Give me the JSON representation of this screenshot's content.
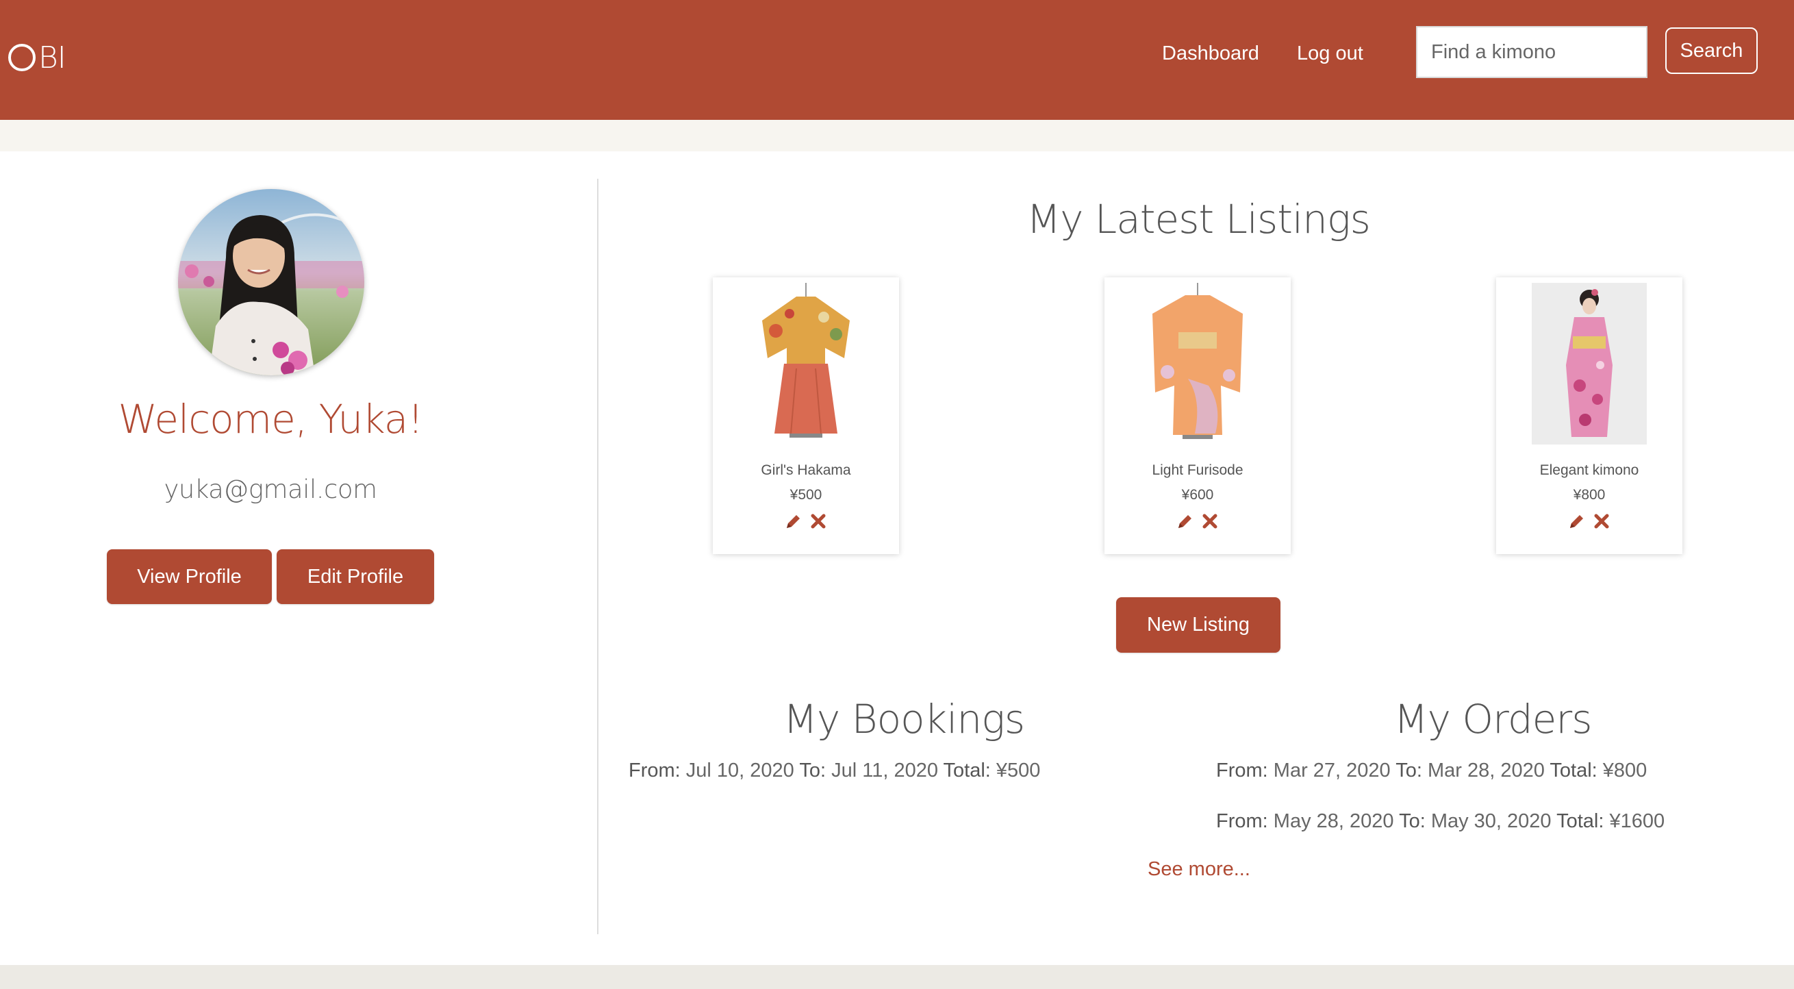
{
  "brand": {
    "logo_text": "BI",
    "accent": "#b04a33"
  },
  "nav": {
    "dashboard": "Dashboard",
    "logout": "Log out",
    "search_placeholder": "Find a kimono",
    "search_button": "Search"
  },
  "profile": {
    "welcome": "Welcome, Yuka!",
    "email": "yuka@gmail.com",
    "view_button": "View Profile",
    "edit_button": "Edit Profile"
  },
  "listings": {
    "title": "My Latest Listings",
    "items": [
      {
        "name": "Girl's Hakama",
        "price": "¥500",
        "image": "kimono-hakama-image"
      },
      {
        "name": "Light Furisode",
        "price": "¥600",
        "image": "kimono-furisode-image"
      },
      {
        "name": "Elegant kimono",
        "price": "¥800",
        "image": "kimono-elegant-image"
      }
    ],
    "new_button": "New Listing"
  },
  "labels": {
    "from": "From:",
    "to": "To:",
    "total": "Total:"
  },
  "bookings": {
    "title": "My Bookings",
    "rows": [
      {
        "from": "Jul 10, 2020",
        "to": "Jul 11, 2020",
        "total": "¥500"
      }
    ]
  },
  "orders": {
    "title": "My Orders",
    "rows": [
      {
        "from": "Mar 27, 2020",
        "to": "Mar 28, 2020",
        "total": "¥800"
      },
      {
        "from": "May 28, 2020",
        "to": "May 30, 2020",
        "total": "¥1600"
      }
    ],
    "see_more": "See more..."
  },
  "icons": {
    "edit": "pencil-icon",
    "delete": "close-icon"
  }
}
